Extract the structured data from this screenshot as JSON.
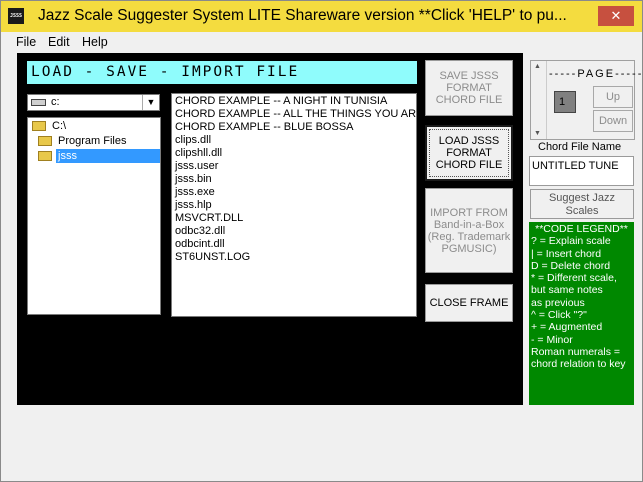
{
  "titlebar": {
    "icon_text": "JSSS",
    "title": "Jazz Scale Suggester System    LITE  Shareware version   **Click 'HELP' to pu...",
    "close_glyph": "✕"
  },
  "menu": [
    "File",
    "Edit",
    "Help"
  ],
  "header": {
    "text": "LOAD - SAVE - IMPORT FILE"
  },
  "drive": {
    "value": "c:",
    "arrow": "▼"
  },
  "directories": [
    {
      "label": "C:\\",
      "selected": false
    },
    {
      "label": "Program Files",
      "selected": false
    },
    {
      "label": "jsss",
      "selected": true
    }
  ],
  "files": [
    "CHORD EXAMPLE -- A NIGHT IN TUNISIA",
    "CHORD EXAMPLE -- ALL THE THINGS YOU ARE",
    "CHORD EXAMPLE -- BLUE BOSSA",
    "clips.dll",
    "clipshll.dll",
    "jsss.user",
    "jsss.bin",
    "jsss.exe",
    "jsss.hlp",
    "MSVCRT.DLL",
    "odbc32.dll",
    "odbcint.dll",
    "ST6UNST.LOG"
  ],
  "buttons": {
    "save_line1": "SAVE JSSS",
    "save_line2": "FORMAT",
    "save_line3": "CHORD FILE",
    "load_line1": "LOAD JSSS",
    "load_line2": "FORMAT",
    "load_line3": "CHORD FILE",
    "import_line1": "IMPORT FROM",
    "import_line2": "Band-in-a-Box",
    "import_line3": "(Reg. Trademark",
    "import_line4": "PGMUSIC)",
    "close_frame": "CLOSE FRAME"
  },
  "page": {
    "label": "-----PAGE-----",
    "number": "1",
    "up": "Up",
    "down": "Down",
    "scroll_up": "▲",
    "scroll_down": "▼"
  },
  "chord_file": {
    "label": "Chord File Name",
    "value": "UNTITLED TUNE"
  },
  "suggest": {
    "line1": "Suggest Jazz",
    "line2": "Scales"
  },
  "legend": {
    "title": "**CODE LEGEND**",
    "lines": [
      "?  = Explain scale",
      "|   = Insert chord",
      "D = Delete chord",
      "*  =  Different scale,",
      "        but same notes",
      "        as previous",
      "^  = Click \"?\"",
      "+  = Augmented",
      "-   = Minor",
      "Roman numerals =",
      "chord relation to key"
    ]
  }
}
